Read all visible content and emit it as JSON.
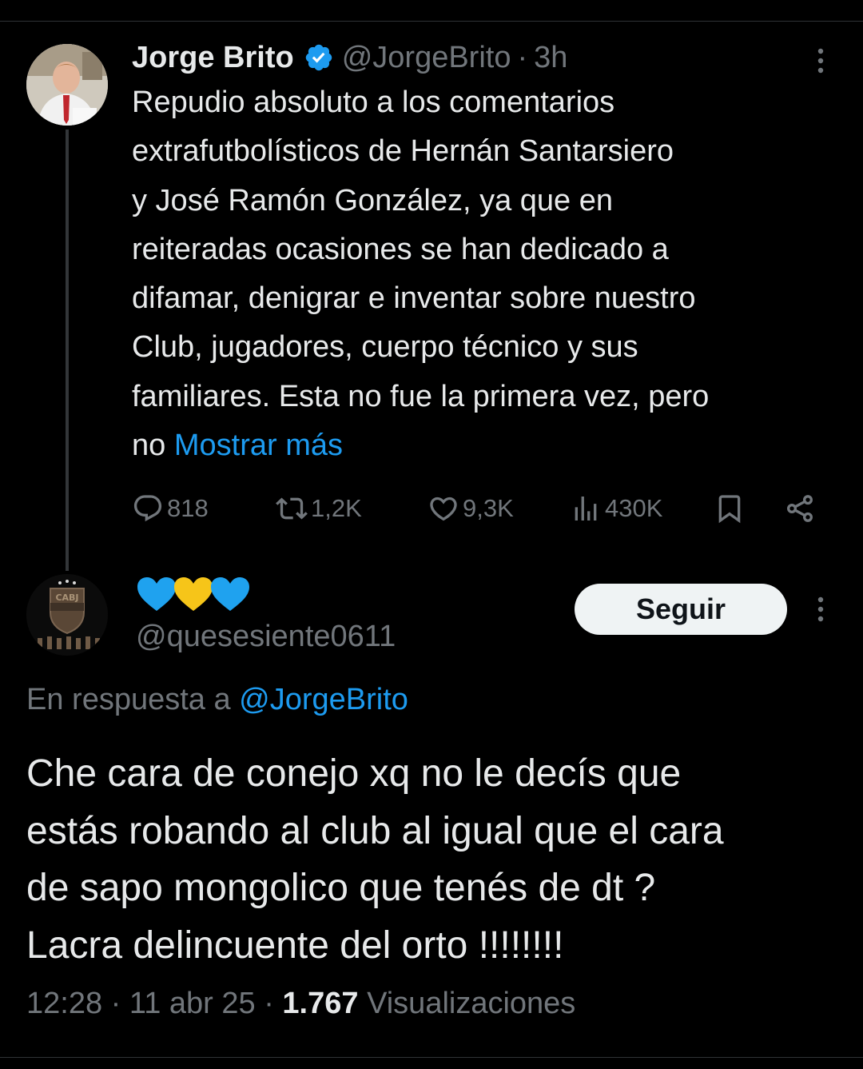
{
  "parent_tweet": {
    "author_name": "Jorge Brito",
    "handle": "@JorgeBrito",
    "separator": "·",
    "time": "3h",
    "text_lines": [
      "Repudio absoluto a los comentarios",
      "extrafutbolísticos de Hernán Santarsiero",
      "y José Ramón González, ya que en",
      "reiteradas ocasiones se han dedicado a",
      "difamar, denigrar e inventar sobre nuestro",
      "Club, jugadores, cuerpo técnico y sus",
      "familiares. Esta no fue la primera vez, pero",
      "no"
    ],
    "show_more": "Mostrar más",
    "metrics": {
      "replies": "818",
      "reposts": "1,2K",
      "likes": "9,3K",
      "views": "430K"
    }
  },
  "reply_tweet": {
    "display_name_emojis": [
      "blue-heart",
      "yellow-heart",
      "blue-heart"
    ],
    "handle": "@quesesiente0611",
    "follow_label": "Seguir",
    "reply_to_prefix": "En respuesta a",
    "reply_to_handle": "@JorgeBrito",
    "text_lines": [
      "Che cara de conejo xq no le decís que",
      "estás robando al club al igual que el cara",
      "de sapo mongolico que tenés de dt ?",
      "Lacra delincuente del orto !!!!!!!!"
    ],
    "time": "12:28",
    "date": "11 abr 25",
    "separator": "·",
    "view_count": "1.767",
    "views_label": "Visualizaciones"
  },
  "colors": {
    "background": "#000000",
    "text": "#e7e9ea",
    "secondary": "#71767b",
    "link": "#1d9bf0",
    "verified": "#1d9bf0",
    "heart_blue": "#1fa2ef",
    "heart_yellow": "#f6c519"
  }
}
